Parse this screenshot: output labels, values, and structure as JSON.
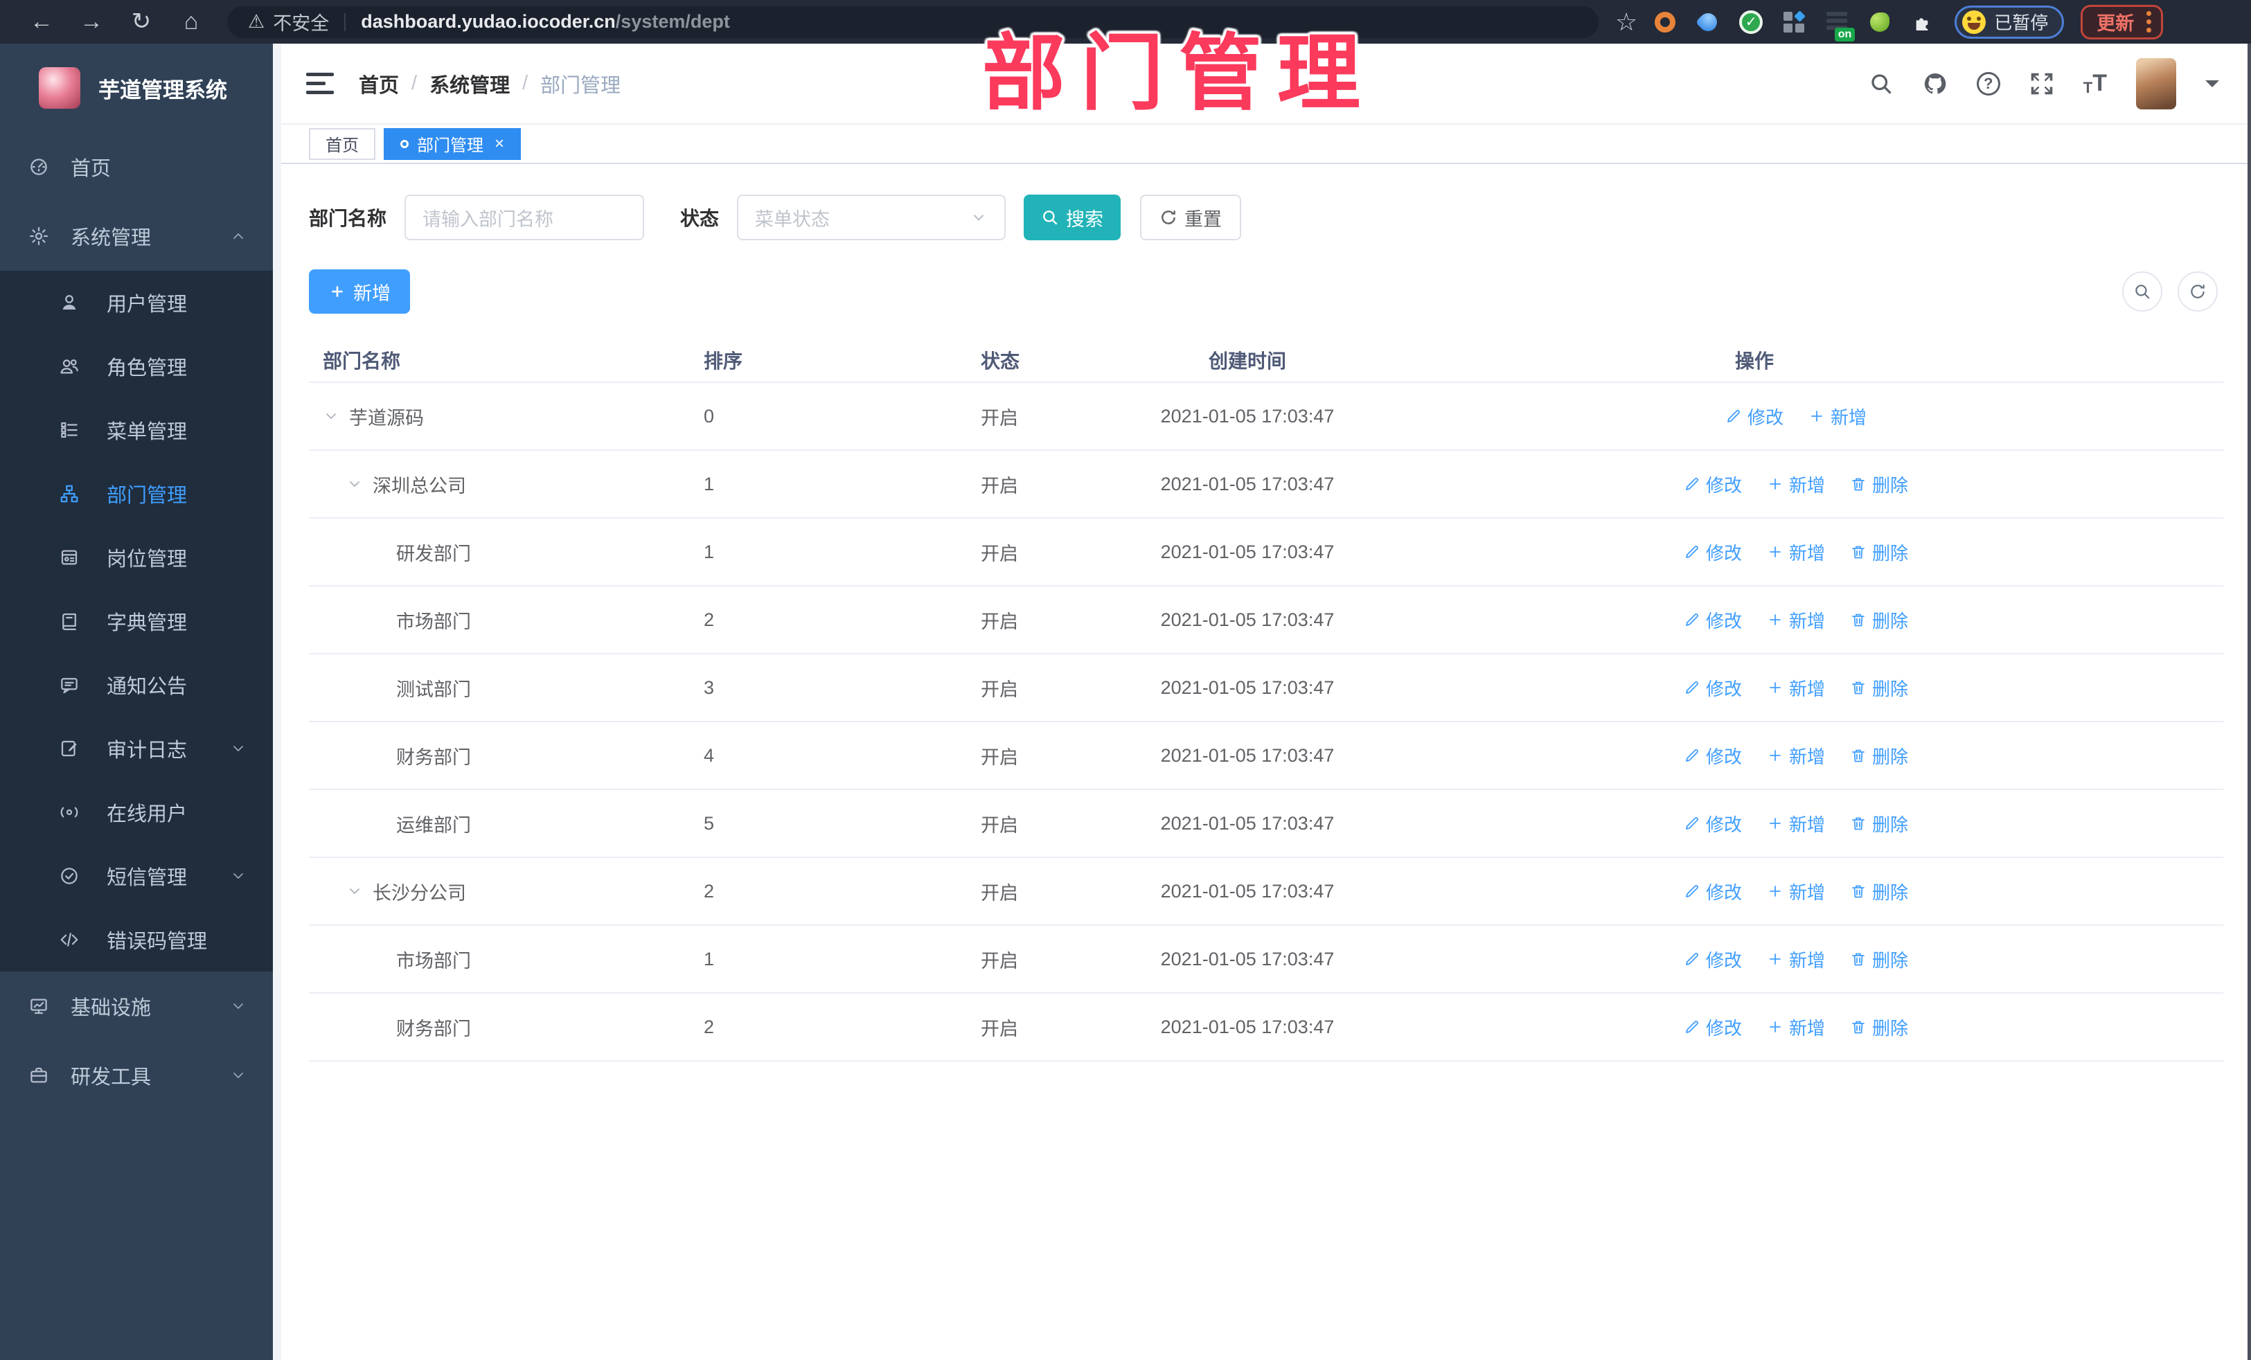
{
  "browser": {
    "security_label": "不安全",
    "url_domain": "dashboard.yudao.iocoder.cn",
    "url_path": "/system/dept",
    "extension_badge": "on",
    "extensions": [
      "orange-ring-extension-icon",
      "blue-drop-extension-icon",
      "green-check-extension-icon",
      "grid-extension-icon",
      "proxy-on-extension-icon",
      "green-leaf-extension-icon",
      "puzzle-extensions-icon"
    ],
    "profile_chip": {
      "label": "已暂停"
    },
    "update_button": "更新"
  },
  "overlay_title": "部门管理",
  "sidebar": {
    "app_title": "芋道管理系统",
    "items": [
      {
        "key": "home",
        "label": "首页",
        "icon": "dashboard-icon",
        "level": 0
      },
      {
        "key": "system-mgmt",
        "label": "系统管理",
        "icon": "gear-icon",
        "level": 0,
        "chevron": "up"
      },
      {
        "key": "user-mgmt",
        "label": "用户管理",
        "icon": "user-icon",
        "level": 1
      },
      {
        "key": "role-mgmt",
        "label": "角色管理",
        "icon": "users-icon",
        "level": 1
      },
      {
        "key": "menu-mgmt",
        "label": "菜单管理",
        "icon": "menu-tree-icon",
        "level": 1
      },
      {
        "key": "dept-mgmt",
        "label": "部门管理",
        "icon": "org-tree-icon",
        "level": 1,
        "active": true
      },
      {
        "key": "post-mgmt",
        "label": "岗位管理",
        "icon": "badge-icon",
        "level": 1
      },
      {
        "key": "dict-mgmt",
        "label": "字典管理",
        "icon": "dictionary-icon",
        "level": 1
      },
      {
        "key": "notice",
        "label": "通知公告",
        "icon": "announcement-icon",
        "level": 1
      },
      {
        "key": "audit-log",
        "label": "审计日志",
        "icon": "audit-log-icon",
        "level": 1,
        "chevron": "down"
      },
      {
        "key": "online-users",
        "label": "在线用户",
        "icon": "online-user-icon",
        "level": 1
      },
      {
        "key": "sms-mgmt",
        "label": "短信管理",
        "icon": "sms-icon",
        "level": 1,
        "chevron": "down"
      },
      {
        "key": "error-code-mgmt",
        "label": "错误码管理",
        "icon": "error-code-icon",
        "level": 1
      },
      {
        "key": "infrastructure",
        "label": "基础设施",
        "icon": "infrastructure-icon",
        "level": 0,
        "chevron": "down"
      },
      {
        "key": "dev-tools",
        "label": "研发工具",
        "icon": "dev-tools-icon",
        "level": 0,
        "chevron": "down"
      }
    ]
  },
  "header": {
    "breadcrumb": [
      "首页",
      "系统管理",
      "部门管理"
    ],
    "right_icons": [
      "search-icon",
      "github-icon",
      "help-icon",
      "fullscreen-icon",
      "font-size-icon"
    ]
  },
  "tabs": [
    {
      "label": "首页",
      "active": false
    },
    {
      "label": "部门管理",
      "active": true,
      "closable": true
    }
  ],
  "filters": {
    "dept_label": "部门名称",
    "dept_placeholder": "请输入部门名称",
    "status_label": "状态",
    "status_placeholder": "菜单状态",
    "search_label": "搜索",
    "reset_label": "重置"
  },
  "toolbar": {
    "add_label": "新增"
  },
  "table": {
    "columns": [
      "部门名称",
      "排序",
      "状态",
      "创建时间",
      "操作"
    ],
    "action_icons": {
      "修改": "edit-icon",
      "新增": "plus-icon",
      "删除": "delete-icon"
    },
    "rows": [
      {
        "name": "芋道源码",
        "level": 0,
        "expandable": true,
        "sort": "0",
        "status": "开启",
        "time": "2021-01-05 17:03:47",
        "actions": [
          "修改",
          "新增"
        ]
      },
      {
        "name": "深圳总公司",
        "level": 1,
        "expandable": true,
        "sort": "1",
        "status": "开启",
        "time": "2021-01-05 17:03:47",
        "actions": [
          "修改",
          "新增",
          "删除"
        ]
      },
      {
        "name": "研发部门",
        "level": 2,
        "expandable": false,
        "sort": "1",
        "status": "开启",
        "time": "2021-01-05 17:03:47",
        "actions": [
          "修改",
          "新增",
          "删除"
        ]
      },
      {
        "name": "市场部门",
        "level": 2,
        "expandable": false,
        "sort": "2",
        "status": "开启",
        "time": "2021-01-05 17:03:47",
        "actions": [
          "修改",
          "新增",
          "删除"
        ]
      },
      {
        "name": "测试部门",
        "level": 2,
        "expandable": false,
        "sort": "3",
        "status": "开启",
        "time": "2021-01-05 17:03:47",
        "actions": [
          "修改",
          "新增",
          "删除"
        ]
      },
      {
        "name": "财务部门",
        "level": 2,
        "expandable": false,
        "sort": "4",
        "status": "开启",
        "time": "2021-01-05 17:03:47",
        "actions": [
          "修改",
          "新增",
          "删除"
        ]
      },
      {
        "name": "运维部门",
        "level": 2,
        "expandable": false,
        "sort": "5",
        "status": "开启",
        "time": "2021-01-05 17:03:47",
        "actions": [
          "修改",
          "新增",
          "删除"
        ]
      },
      {
        "name": "长沙分公司",
        "level": 1,
        "expandable": true,
        "sort": "2",
        "status": "开启",
        "time": "2021-01-05 17:03:47",
        "actions": [
          "修改",
          "新增",
          "删除"
        ]
      },
      {
        "name": "市场部门",
        "level": 2,
        "expandable": false,
        "sort": "1",
        "status": "开启",
        "time": "2021-01-05 17:03:47",
        "actions": [
          "修改",
          "新增",
          "删除"
        ]
      },
      {
        "name": "财务部门",
        "level": 2,
        "expandable": false,
        "sort": "2",
        "status": "开启",
        "time": "2021-01-05 17:03:47",
        "actions": [
          "修改",
          "新增",
          "删除"
        ]
      }
    ]
  },
  "colors": {
    "accent_blue": "#409eff",
    "tab_active_blue": "#2f8df2",
    "search_teal": "#21b3b7",
    "sidebar_bg": "#304156",
    "submenu_bg": "#1f2d3d",
    "sidebar_text": "#bfcbd9",
    "overlay_pink": "#fb3a5c",
    "table_border": "#ebeef5",
    "header_text": "#4f5a77",
    "body_text": "#606266",
    "browser_bar_bg": "#242a37"
  }
}
